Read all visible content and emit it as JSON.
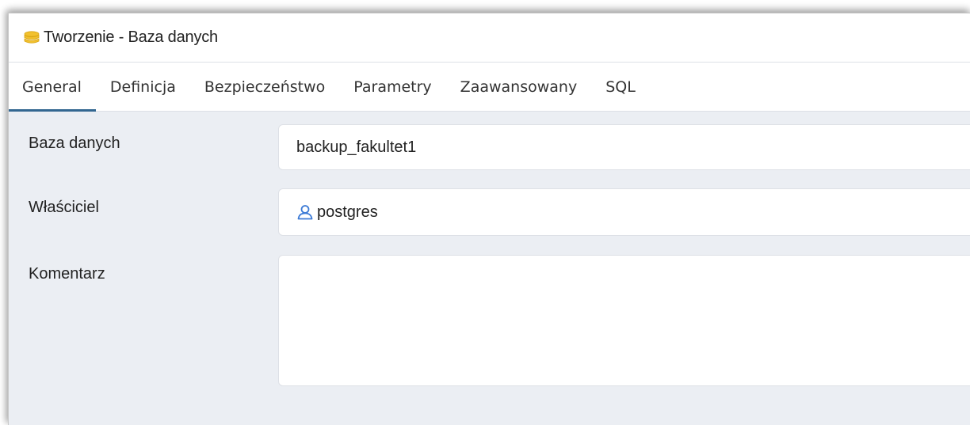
{
  "dialog": {
    "title": "Tworzenie - Baza danych",
    "icon": "database-icon"
  },
  "tabs": [
    {
      "label": "General",
      "active": true
    },
    {
      "label": "Definicja",
      "active": false
    },
    {
      "label": "Bezpieczeństwo",
      "active": false
    },
    {
      "label": "Parametry",
      "active": false
    },
    {
      "label": "Zaawansowany",
      "active": false
    },
    {
      "label": "SQL",
      "active": false
    }
  ],
  "form": {
    "database_label": "Baza danych",
    "database_value": "backup_fakultet1",
    "owner_label": "Właściciel",
    "owner_value": "postgres",
    "owner_icon": "user-icon",
    "comment_label": "Komentarz",
    "comment_value": ""
  },
  "colors": {
    "active_tab_underline": "#326690",
    "content_background": "#ebeef3",
    "database_icon": "#f2c12e",
    "user_icon": "#3d7bd6"
  }
}
